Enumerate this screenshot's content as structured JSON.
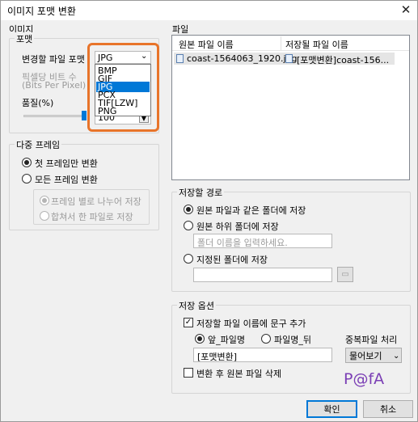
{
  "window": {
    "title": "이미지 포맷 변환",
    "close_glyph": "✕"
  },
  "image_section": {
    "title": "이미지",
    "format_group": {
      "title": "포맷",
      "format_label": "변경할 파일 포맷",
      "selected_format": "JPG",
      "format_options": [
        "BMP",
        "GIF",
        "JPG",
        "PCX",
        "TIF[LZW]",
        "PNG"
      ],
      "bit_depth_label_line1": "픽셀당 비트 수",
      "bit_depth_label_line2": "(Bits Per Pixel)",
      "quality_label": "품질(%)",
      "quality_value": "100"
    },
    "multiframe_group": {
      "title": "다중 프레임",
      "first_frame_only": "첫 프레임만 변환",
      "all_frames": "모든 프레임 변환",
      "split_by_frame": "프레임 별로 나누어 저장",
      "merge_one_file": "합쳐서 한 파일로 저장"
    }
  },
  "file_section": {
    "title": "파일",
    "columns": [
      "원본 파일 이름",
      "저장될 파일 이름"
    ],
    "rows": [
      {
        "source": "coast-1564063_1920.jpg",
        "target": "[포맷변환]coast-156..."
      }
    ]
  },
  "save_path": {
    "title": "저장할 경로",
    "same_folder": "원본 파일과 같은 폴더에 저장",
    "subfolder": "원본 하위 폴더에 저장",
    "subfolder_placeholder": "폴더 이름을 입력하세요.",
    "specified_folder": "지정된 폴더에 저장",
    "specified_value": ""
  },
  "save_options": {
    "title": "저장 옵션",
    "add_text_label": "저장할 파일 이름에 문구 추가",
    "add_text_checked": true,
    "front_filename": "앞_파일명",
    "filename_back": "파일명_뒤",
    "text_value": "[포맷변환]",
    "duplicate_label": "중복파일 처리",
    "duplicate_value": "물어보기",
    "delete_original_label": "변환 후 원본 파일 삭제",
    "delete_original_checked": false
  },
  "watermark": "P@fA",
  "buttons": {
    "ok": "확인",
    "cancel": "취소"
  },
  "colors": {
    "highlight_border": "#e8742a",
    "selection": "#0078d7",
    "watermark": "#7b3fb5"
  }
}
